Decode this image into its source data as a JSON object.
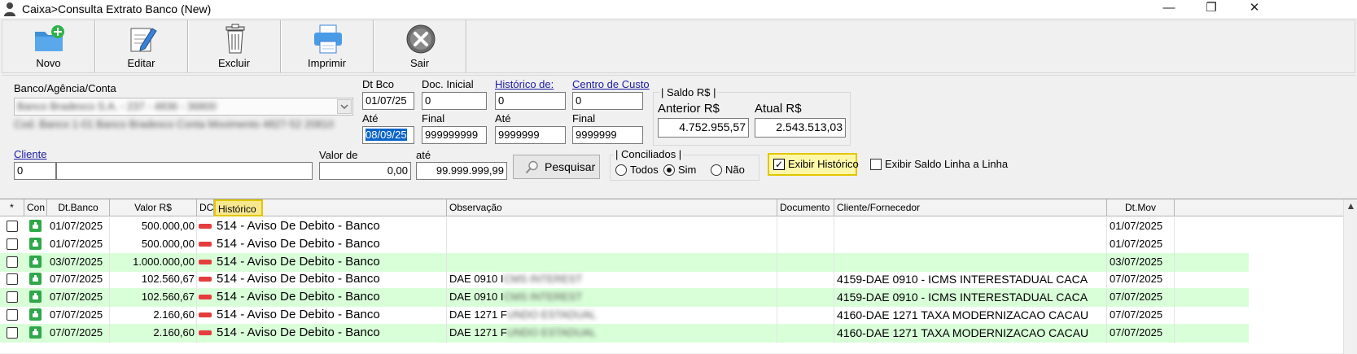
{
  "window": {
    "title": "Caixa>Consulta Extrato Banco (New)",
    "icon": "user-icon",
    "minimize": "—",
    "maximize": "❐",
    "close": "✕"
  },
  "toolbar": {
    "novo": "Novo",
    "editar": "Editar",
    "excluir": "Excluir",
    "imprimir": "Imprimir",
    "sair": "Sair"
  },
  "filters": {
    "banco_label": "Banco/Agência/Conta",
    "banco_value": "Banco Bradesco S.A. - 237 - 4836 - 36800",
    "banco_info": "Cod. Banco 1-01 Banco Bradesco Conta Movimento 4827-52 20810",
    "dt_bco_label": "Dt Bco",
    "dt_bco_value": "01/07/25",
    "ate_label": "Até",
    "ate_value": "08/09/25",
    "doc_inicial_label": "Doc. Inicial",
    "doc_inicial_value": "0",
    "final_label": "Final",
    "final_value": "999999999",
    "historico_label": "Histórico de:",
    "historico_value": "0",
    "historico_ate_label": "Até",
    "historico_ate_value": "9999999",
    "centro_label": "Centro de Custo",
    "centro_value": "0",
    "centro_final_label": "Final",
    "centro_final_value": "9999999",
    "cliente_label": "Cliente",
    "cliente_code": "0",
    "cliente_name": "",
    "valor_de_label": "Valor de",
    "valor_de_value": "0,00",
    "valor_ate_label": "até",
    "valor_ate_value": "99.999.999,99",
    "pesquisar": "Pesquisar"
  },
  "saldo": {
    "title": "| Saldo R$ |",
    "anterior_label": "Anterior R$",
    "anterior_value": "4.752.955,57",
    "atual_label": "Atual R$",
    "atual_value": "2.543.513,03"
  },
  "conciliados": {
    "title": "| Conciliados |",
    "todos": "Todos",
    "sim": "Sim",
    "nao": "Não",
    "selected": "Sim"
  },
  "options": {
    "exibir_historico": "Exibir Histórico",
    "exibir_historico_checked": true,
    "exibir_saldo": "Exibir Saldo Linha a Linha",
    "exibir_saldo_checked": false
  },
  "grid": {
    "columns": [
      "*",
      "Con",
      "Dt.Banco",
      "Valor R$",
      "DC",
      "Histórico",
      "Observação",
      "Documento",
      "Cliente/Fornecedor",
      "Dt.Mov"
    ],
    "rows": [
      {
        "dt_banco": "01/07/2025",
        "valor": "500.000,00",
        "historico": "514 - Aviso De Debito - Banco",
        "obs": "",
        "obs_hidden": "",
        "documento": "",
        "cliente": "",
        "dt_mov": "01/07/2025"
      },
      {
        "dt_banco": "01/07/2025",
        "valor": "500.000,00",
        "historico": "514 - Aviso De Debito - Banco",
        "obs": "",
        "obs_hidden": "",
        "documento": "",
        "cliente": "",
        "dt_mov": "01/07/2025"
      },
      {
        "dt_banco": "03/07/2025",
        "valor": "1.000.000,00",
        "historico": "514 - Aviso De Debito - Banco",
        "obs": "",
        "obs_hidden": "",
        "documento": "",
        "cliente": "",
        "dt_mov": "03/07/2025"
      },
      {
        "dt_banco": "07/07/2025",
        "valor": "102.560,67",
        "historico": "514 - Aviso De Debito - Banco",
        "obs": "DAE 0910 I",
        "obs_hidden": "CMS INTEREST",
        "documento": "",
        "cliente": "4159-DAE 0910 - ICMS INTERESTADUAL CACA",
        "dt_mov": "07/07/2025"
      },
      {
        "dt_banco": "07/07/2025",
        "valor": "102.560,67",
        "historico": "514 - Aviso De Debito - Banco",
        "obs": "DAE 0910 I",
        "obs_hidden": "CMS INTEREST",
        "documento": "",
        "cliente": "4159-DAE 0910 - ICMS INTERESTADUAL CACA",
        "dt_mov": "07/07/2025"
      },
      {
        "dt_banco": "07/07/2025",
        "valor": "2.160,60",
        "historico": "514 - Aviso De Debito - Banco",
        "obs": "DAE 1271 F",
        "obs_hidden": "UNDO ESTADUAL",
        "documento": "",
        "cliente": "4160-DAE 1271 TAXA MODERNIZACAO CACAU",
        "dt_mov": "07/07/2025"
      },
      {
        "dt_banco": "07/07/2025",
        "valor": "2.160,60",
        "historico": "514 - Aviso De Debito - Banco",
        "obs": "DAE 1271 F",
        "obs_hidden": "UNDO ESTADUAL",
        "documento": "",
        "cliente": "4160-DAE 1271 TAXA MODERNIZACAO CACAU",
        "dt_mov": "07/07/2025"
      }
    ]
  },
  "colors": {
    "row_alt": "#d9ffd9",
    "highlight": "#f7e88e",
    "selection": "#0a64c8",
    "conciliado": "#2fa84a",
    "debit": "#e53d3d",
    "link": "#1a1aa6"
  }
}
